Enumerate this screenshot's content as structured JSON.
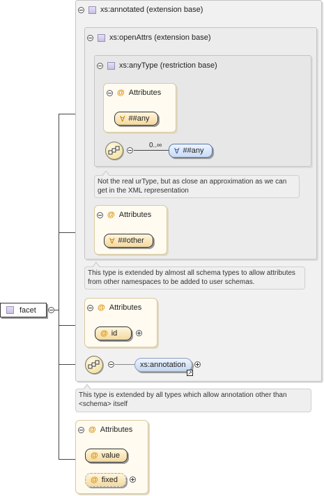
{
  "root": {
    "label": "facet",
    "icon": "complex-type-icon"
  },
  "annotated": {
    "label": "xs:annotated (extension base)",
    "note": "This type is extended by all types which allow annotation other than <schema> itself"
  },
  "openAttrs": {
    "label": "xs:openAttrs (extension base)",
    "note": "This type is extended by almost all schema types to allow attributes from other namespaces to be added to user schemas."
  },
  "anyType": {
    "label": "xs:anyType (restriction base)",
    "attributes_label": "Attributes",
    "any_attr": "##any",
    "cardinality": "0..∞",
    "any_elem": "##any",
    "note": "Not the real urType, but as close an approximation as we can get in the XML representation"
  },
  "openAttrs_attrs": {
    "label": "Attributes",
    "other": "##other"
  },
  "annotated_attrs": {
    "label": "Attributes",
    "id": "id"
  },
  "annotation_elem": {
    "label": "xs:annotation"
  },
  "facet_attrs": {
    "label": "Attributes",
    "items": [
      "value",
      "fixed"
    ]
  }
}
